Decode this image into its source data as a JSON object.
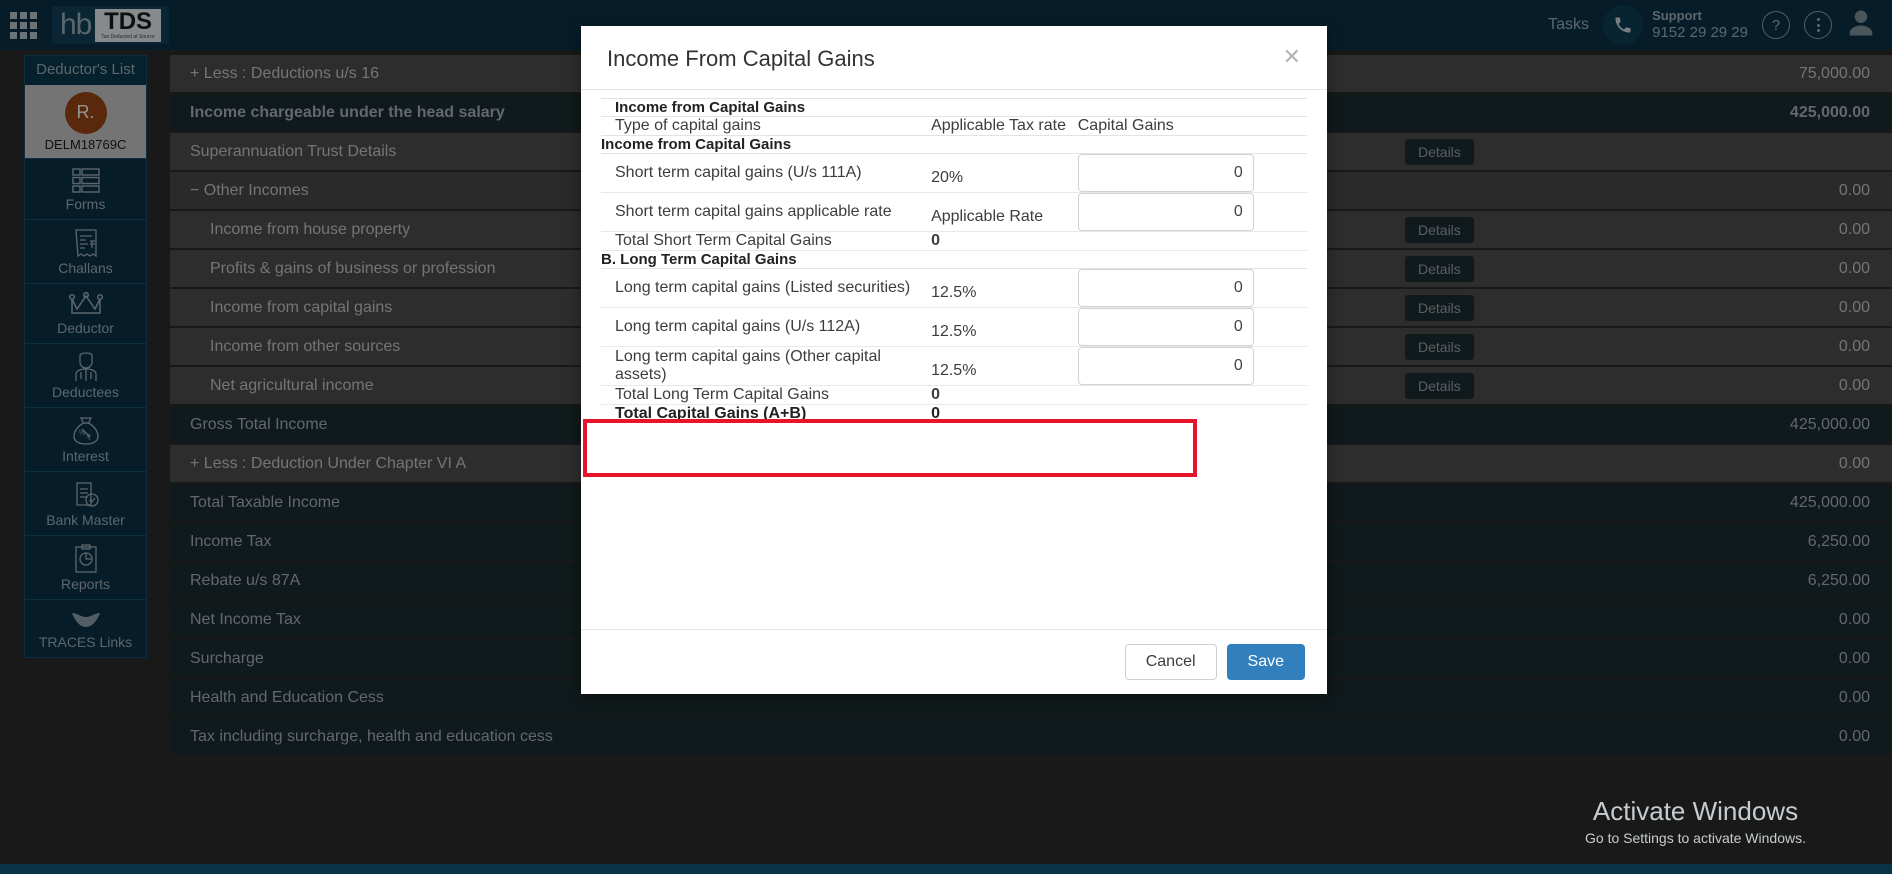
{
  "topbar": {
    "grid_icon": "apps-grid-icon",
    "logo_hb": "hb",
    "logo_tds": "TDS",
    "logo_tagline": "Tax Deducted at Source",
    "tasks_label": "Tasks",
    "support_label": "Support",
    "support_phone": "9152 29 29 29",
    "help_icon": "?",
    "kebab_icon": "more-vertical-icon",
    "avatar_icon": "user-avatar-icon"
  },
  "sidebar": {
    "header": "Deductor's List",
    "avatar_initial": "R.",
    "pan": "DELM18769C",
    "items": [
      {
        "label": "Forms",
        "icon": "forms-icon"
      },
      {
        "label": "Challans",
        "icon": "receipt-icon"
      },
      {
        "label": "Deductor",
        "icon": "crown-icon"
      },
      {
        "label": "Deductees",
        "icon": "person-icon"
      },
      {
        "label": "Interest",
        "icon": "money-bag-icon"
      },
      {
        "label": "Bank Master",
        "icon": "document-check-icon"
      },
      {
        "label": "Reports",
        "icon": "clipboard-chart-icon"
      },
      {
        "label": "TRACES Links",
        "icon": "traces-icon"
      }
    ]
  },
  "main": {
    "details_label": "Details",
    "rows": [
      {
        "label": "+ Less : Deductions u/s 16",
        "style": "lvl0",
        "indent": 0,
        "details": false,
        "value": "75,000.00"
      },
      {
        "label": "Income chargeable under the head salary",
        "style": "dark",
        "indent": 0,
        "details": false,
        "value": "425,000.00",
        "bold": true
      },
      {
        "label": "Superannuation Trust Details",
        "style": "lvl0",
        "indent": 0,
        "details": true,
        "value": ""
      },
      {
        "label": "− Other Incomes",
        "style": "lvl1",
        "indent": 0,
        "details": false,
        "value": "0.00"
      },
      {
        "label": "Income from house property",
        "style": "lvl0",
        "indent": 1,
        "details": true,
        "value": "0.00"
      },
      {
        "label": "Profits & gains of business or profession",
        "style": "lvl0",
        "indent": 1,
        "details": true,
        "value": "0.00"
      },
      {
        "label": "Income from capital gains",
        "style": "lvl0",
        "indent": 1,
        "details": true,
        "value": "0.00"
      },
      {
        "label": "Income from other sources",
        "style": "lvl0",
        "indent": 1,
        "details": true,
        "value": "0.00"
      },
      {
        "label": "Net agricultural income",
        "style": "lvl0",
        "indent": 1,
        "details": true,
        "value": "0.00"
      },
      {
        "label": "Gross Total Income",
        "style": "dark",
        "indent": 0,
        "details": false,
        "value": "425,000.00"
      },
      {
        "label": "+ Less : Deduction Under Chapter VI A",
        "style": "lvl0",
        "indent": 0,
        "details": false,
        "value": "0.00"
      },
      {
        "label": "Total Taxable Income",
        "style": "dark",
        "indent": 0,
        "details": false,
        "value": "425,000.00"
      },
      {
        "label": "Income Tax",
        "style": "dark",
        "indent": 0,
        "details": false,
        "value": "6,250.00"
      },
      {
        "label": "Rebate u/s 87A",
        "style": "dark",
        "indent": 0,
        "details": false,
        "value": "6,250.00"
      },
      {
        "label": "Net Income Tax",
        "style": "dark",
        "indent": 0,
        "details": false,
        "value": "0.00"
      },
      {
        "label": "Surcharge",
        "style": "dark",
        "indent": 0,
        "details": false,
        "value": "0.00"
      },
      {
        "label": "Health and Education Cess",
        "style": "dark",
        "indent": 0,
        "details": false,
        "value": "0.00"
      },
      {
        "label": "Tax including surcharge, health and education cess",
        "style": "dark",
        "indent": 0,
        "details": false,
        "value": "0.00"
      }
    ]
  },
  "modal": {
    "title": "Income From Capital Gains",
    "close_icon": "close-icon",
    "section_title": "Income from Capital Gains",
    "columns": {
      "type": "Type of capital gains",
      "rate": "Applicable Tax rate",
      "gains": "Capital Gains"
    },
    "section_a_title": "Income from Capital Gains",
    "short_term_rows": [
      {
        "name": "Short term capital gains (U/s 111A)",
        "rate": "20%",
        "value": "0"
      },
      {
        "name": "Short term capital gains applicable rate",
        "rate": "Applicable Rate",
        "value": "0"
      }
    ],
    "short_term_total_label": "Total Short Term Capital Gains",
    "short_term_total_value": "0",
    "section_b_title": "B. Long Term Capital Gains",
    "long_term_rows": [
      {
        "name": "Long term capital gains (Listed securities)",
        "rate": "12.5%",
        "value": "0"
      },
      {
        "name": "Long term capital gains (U/s 112A)",
        "rate": "12.5%",
        "value": "0"
      },
      {
        "name": "Long term capital gains (Other capital assets)",
        "rate": "12.5%",
        "value": "0"
      }
    ],
    "long_term_total_label": "Total Long Term Capital Gains",
    "long_term_total_value": "0",
    "grand_total_label": "Total Capital Gains (A+B)",
    "grand_total_value": "0",
    "cancel_label": "Cancel",
    "save_label": "Save",
    "highlight_color": "#e8152a"
  },
  "watermark": {
    "line1": "Activate Windows",
    "line2": "Go to Settings to activate Windows."
  }
}
